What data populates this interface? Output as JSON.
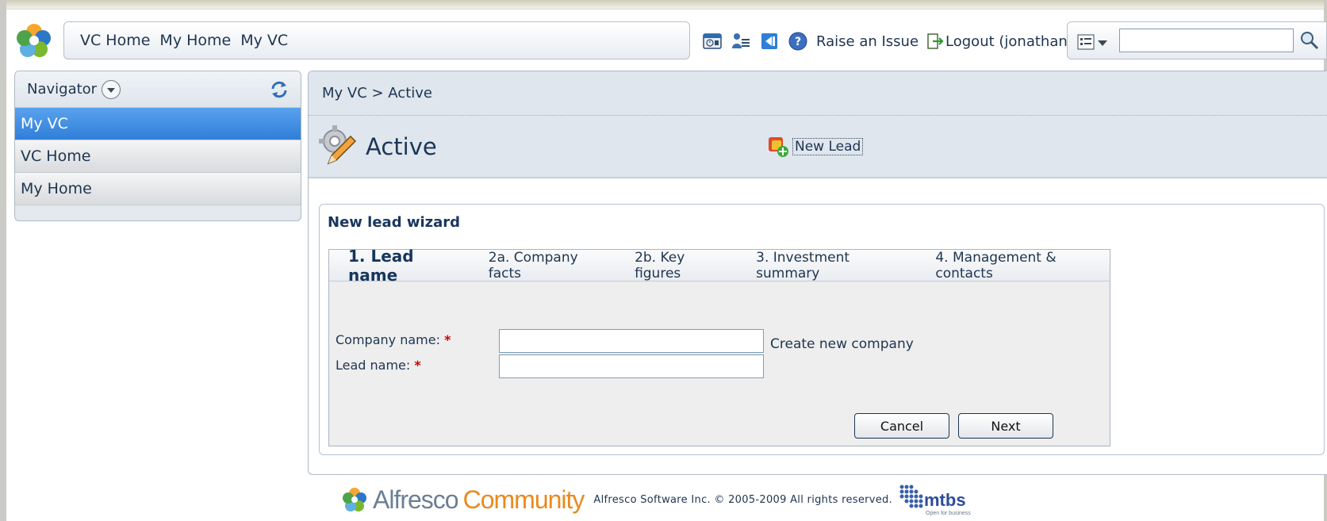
{
  "header": {
    "breadcrumbs": [
      "VC Home",
      "My Home",
      "My VC"
    ],
    "raise_issue": "Raise an Issue",
    "logout": "Logout (jonathan)",
    "search": {
      "value": "",
      "placeholder": ""
    }
  },
  "navigator": {
    "title": "Navigator",
    "items": [
      {
        "label": "My VC",
        "active": true
      },
      {
        "label": "VC Home",
        "active": false
      },
      {
        "label": "My Home",
        "active": false
      }
    ]
  },
  "main": {
    "breadcrumb": "My VC > Active",
    "title": "Active",
    "new_lead": "New Lead"
  },
  "wizard": {
    "title": "New lead wizard",
    "steps": [
      "1. Lead name",
      "2a. Company facts",
      "2b. Key figures",
      "3. Investment summary",
      "4. Management & contacts"
    ],
    "company_label": "Company name:",
    "lead_label": "Lead name:",
    "required_mark": "*",
    "company_value": "",
    "lead_value": "",
    "create_company": "Create new company",
    "cancel": "Cancel",
    "next": "Next"
  },
  "footer": {
    "brand_a": "Alfresco",
    "brand_b": "Community",
    "copyright": "Alfresco Software Inc. © 2005-2009 All rights reserved.",
    "partner_logo_text": "MTBS Open for business"
  },
  "colors": {
    "accent": "#2f7ed8",
    "panel_bg": "#dfe6ee",
    "title_text": "#17365d",
    "required": "#cc0000",
    "brand_orange": "#e98a1d"
  },
  "icons": [
    "alfresco-logo",
    "calendar-icon",
    "users-icon",
    "import-icon",
    "help-icon",
    "logout-icon",
    "search-options-icon",
    "search-icon",
    "refresh-icon",
    "gear-pencil-icon",
    "new-lead-icon",
    "mtbs-logo"
  ]
}
